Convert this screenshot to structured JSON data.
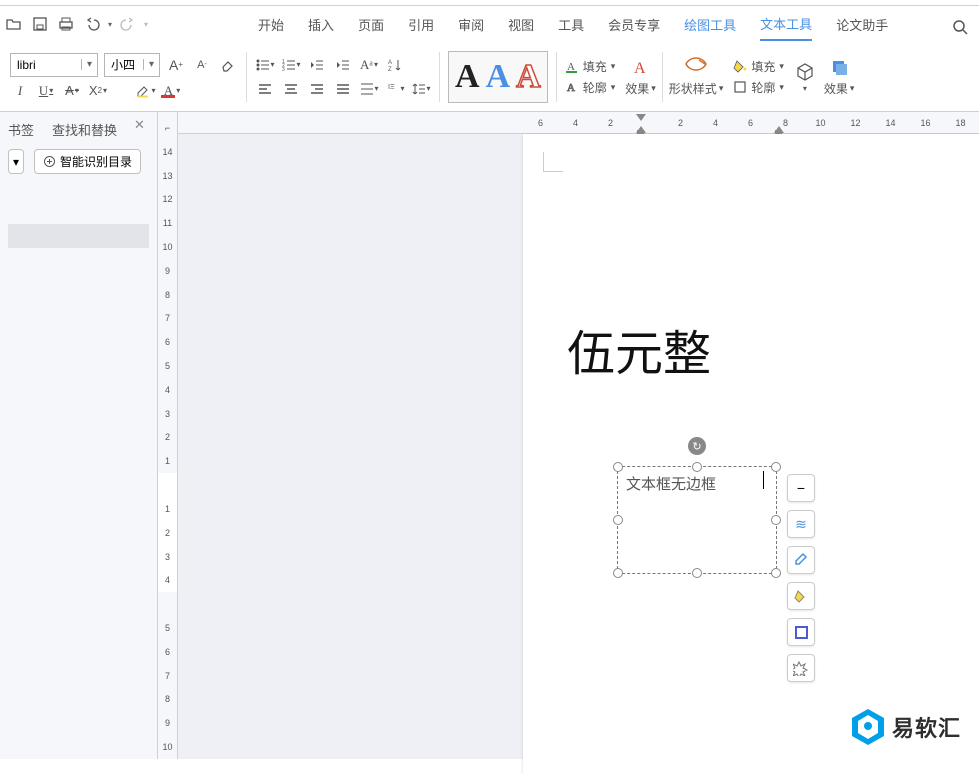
{
  "tabs": {
    "start": "开始",
    "insert": "插入",
    "page": "页面",
    "ref": "引用",
    "review": "审阅",
    "view": "视图",
    "tool": "工具",
    "member": "会员专享",
    "drawing": "绘图工具",
    "text": "文本工具",
    "thesis": "论文助手"
  },
  "font": {
    "name": "libri",
    "size": "小四"
  },
  "sidebar": {
    "tab_bookmark": "书签",
    "tab_findreplace": "查找和替换",
    "auto_toc": "智能识别目录"
  },
  "ribbon": {
    "fill": "填充",
    "outline": "轮廓",
    "effect": "效果",
    "shape_style": "形状样式",
    "fill2": "填充",
    "outline2": "轮廓",
    "effect2": "效果"
  },
  "doc": {
    "heading": "伍元整",
    "textbox": "文本框无边框"
  },
  "brand": {
    "name": "易软汇"
  },
  "hruler": [
    "6",
    "4",
    "2",
    "",
    "2",
    "4",
    "6",
    "8",
    "10",
    "12",
    "14",
    "16",
    "18"
  ],
  "vruler": [
    "14",
    "13",
    "12",
    "11",
    "10",
    "9",
    "8",
    "7",
    "6",
    "5",
    "4",
    "3",
    "2",
    "1",
    "",
    "1",
    "2",
    "3",
    "4",
    "",
    "5",
    "6",
    "7",
    "8",
    "9",
    "10"
  ]
}
